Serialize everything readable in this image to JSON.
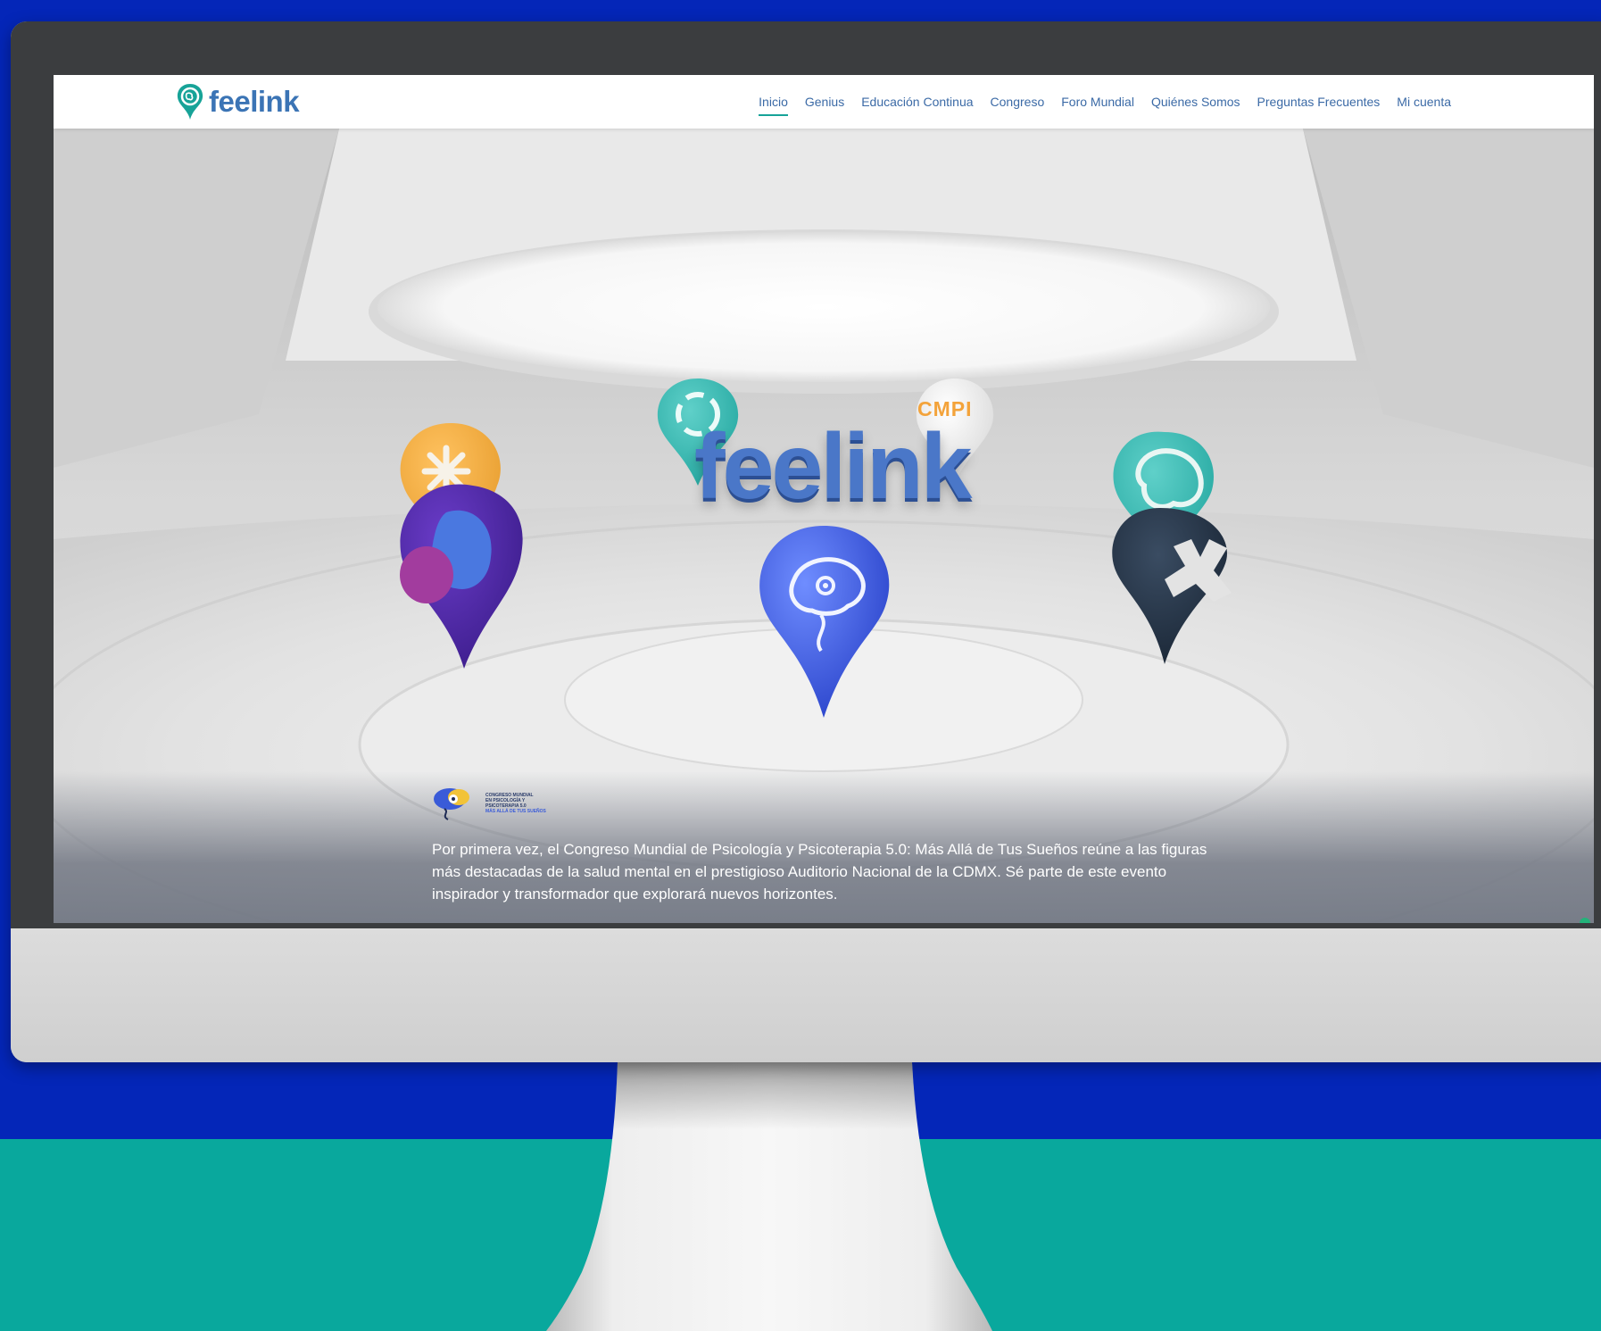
{
  "brand": {
    "name": "feelink"
  },
  "nav": {
    "items": [
      {
        "label": "Inicio",
        "active": true
      },
      {
        "label": "Genius"
      },
      {
        "label": "Educación Continua"
      },
      {
        "label": "Congreso"
      },
      {
        "label": "Foro Mundial"
      },
      {
        "label": "Quiénes Somos"
      },
      {
        "label": "Preguntas Frecuentes"
      },
      {
        "label": "Mi cuenta"
      }
    ]
  },
  "hero": {
    "logo_text": "feelink",
    "cmpi_label": "CMPI",
    "congress_logo": {
      "lines": [
        "CONGRESO MUNDIAL",
        "EN PSICOLOGÍA Y",
        "PSICOTERAPIA 5.0"
      ],
      "tagline": "MÁS ALLÁ DE TUS SUEÑOS"
    },
    "description": "Por primera vez, el Congreso Mundial de Psicología y Psicoterapia 5.0: Más Allá de Tus Sueños reúne a las figuras más destacadas de la salud mental en el prestigioso Auditorio Nacional de la CDMX. Sé parte de este evento inspirador y transformador que explorará nuevos horizontes."
  },
  "colors": {
    "background_blue": "#0426b8",
    "background_teal": "#09a89d",
    "brand_blue": "#3b74b5",
    "nav_active": "#17a398"
  }
}
